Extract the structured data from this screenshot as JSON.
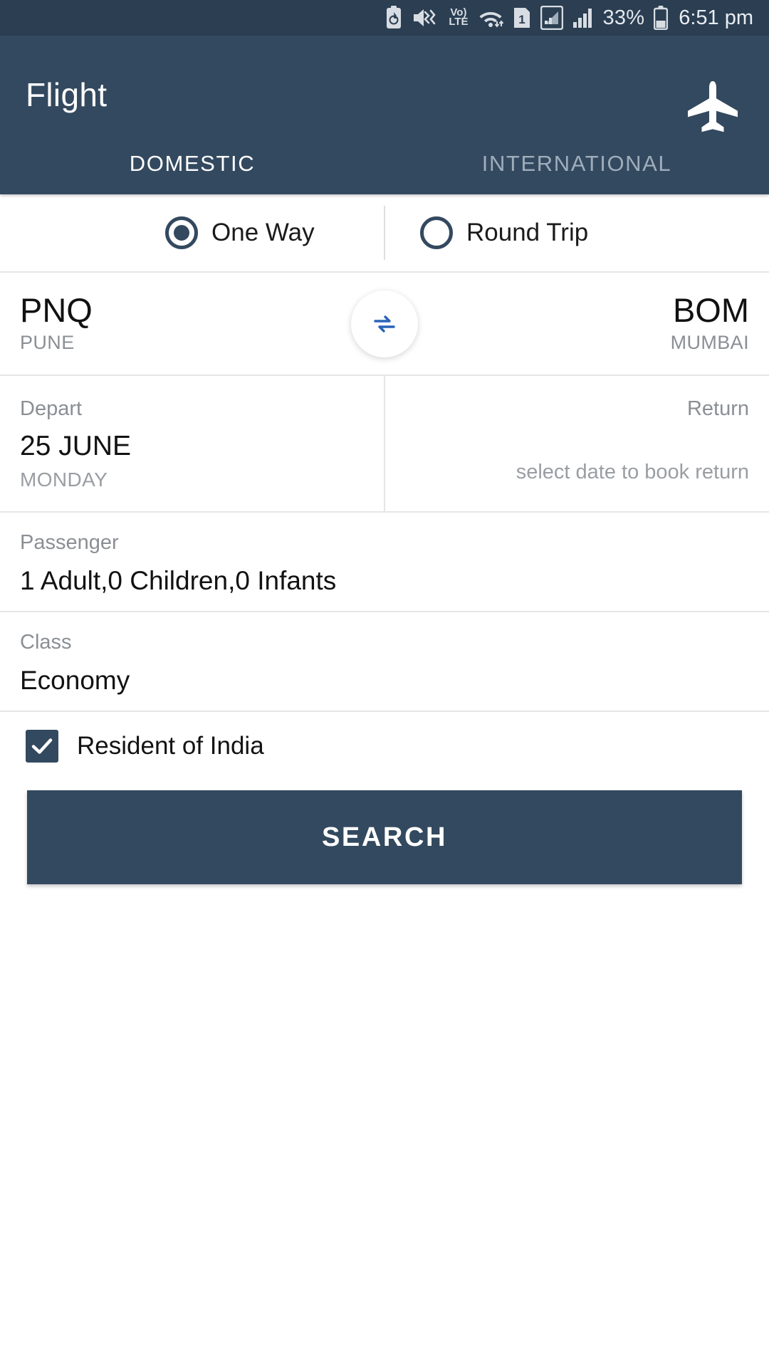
{
  "status_bar": {
    "icons": [
      "battery-saver-icon",
      "mute-vibrate-icon",
      "volte-icon",
      "wifi-icon",
      "sim-1-icon",
      "signal-sim1-icon",
      "signal-sim2-icon"
    ],
    "volte_top": "Vo)",
    "volte_bottom": "LTE",
    "sim_number": "1",
    "battery_percent": "33%",
    "time": "6:51 pm"
  },
  "appbar": {
    "title": "Flight",
    "icon": "airplane-icon",
    "background": "#33495f",
    "tabs": [
      {
        "label": "DOMESTIC",
        "active": true
      },
      {
        "label": "INTERNATIONAL",
        "active": false
      }
    ]
  },
  "trip_type": {
    "options": [
      {
        "label": "One Way",
        "selected": true
      },
      {
        "label": "Round Trip",
        "selected": false
      }
    ]
  },
  "route": {
    "from": {
      "code": "PNQ",
      "city": "PUNE"
    },
    "to": {
      "code": "BOM",
      "city": "MUMBAI"
    },
    "swap_icon": "swap-horizontal-icon",
    "swap_icon_color": "#2a63b8"
  },
  "dates": {
    "depart": {
      "label": "Depart",
      "value": "25 JUNE",
      "day": "MONDAY"
    },
    "return": {
      "label": "Return",
      "hint": "select date to book return"
    }
  },
  "passenger": {
    "label": "Passenger",
    "value": "1 Adult,0 Children,0 Infants"
  },
  "travel_class": {
    "label": "Class",
    "value": "Economy"
  },
  "residency": {
    "label": "Resident of India",
    "checked": true,
    "check_icon": "check-icon"
  },
  "search": {
    "label": "SEARCH",
    "color": "#33495f"
  }
}
